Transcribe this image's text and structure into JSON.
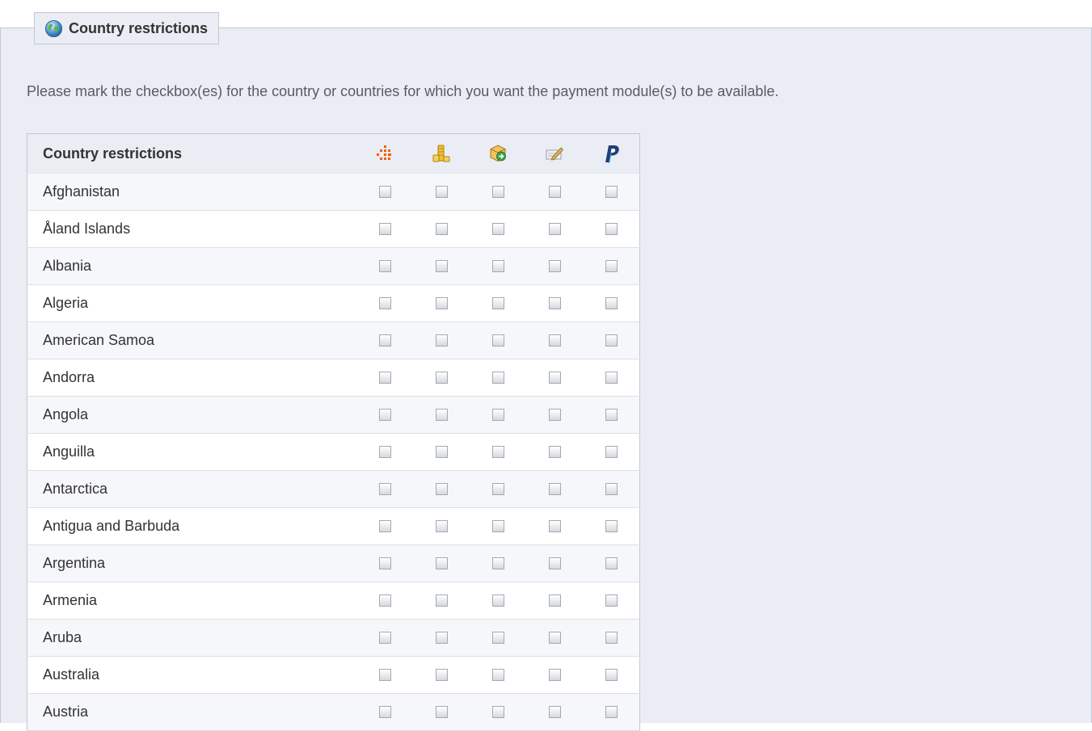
{
  "panel": {
    "legend_title": "Country restrictions",
    "legend_icon": "globe-icon",
    "intro_text": "Please mark the checkbox(es) for the country or countries for which you want the payment module(s) to be available."
  },
  "table": {
    "header": "Country restrictions",
    "modules": [
      {
        "icon": "orange-dots-icon",
        "accent": "#f25c05"
      },
      {
        "icon": "coins-icon",
        "accent": "#e8b520"
      },
      {
        "icon": "box-arrow-icon",
        "accent": "#2e9d3a"
      },
      {
        "icon": "pen-icon",
        "accent": "#c8a04a"
      },
      {
        "icon": "paypal-icon",
        "accent": "#1f3f7a"
      }
    ],
    "rows": [
      {
        "country": "Afghanistan",
        "checked": [
          false,
          false,
          false,
          false,
          false
        ]
      },
      {
        "country": "Åland Islands",
        "checked": [
          false,
          false,
          false,
          false,
          false
        ]
      },
      {
        "country": "Albania",
        "checked": [
          false,
          false,
          false,
          false,
          false
        ]
      },
      {
        "country": "Algeria",
        "checked": [
          false,
          false,
          false,
          false,
          false
        ]
      },
      {
        "country": "American Samoa",
        "checked": [
          false,
          false,
          false,
          false,
          false
        ]
      },
      {
        "country": "Andorra",
        "checked": [
          false,
          false,
          false,
          false,
          false
        ]
      },
      {
        "country": "Angola",
        "checked": [
          false,
          false,
          false,
          false,
          false
        ]
      },
      {
        "country": "Anguilla",
        "checked": [
          false,
          false,
          false,
          false,
          false
        ]
      },
      {
        "country": "Antarctica",
        "checked": [
          false,
          false,
          false,
          false,
          false
        ]
      },
      {
        "country": "Antigua and Barbuda",
        "checked": [
          false,
          false,
          false,
          false,
          false
        ]
      },
      {
        "country": "Argentina",
        "checked": [
          false,
          false,
          false,
          false,
          false
        ]
      },
      {
        "country": "Armenia",
        "checked": [
          false,
          false,
          false,
          false,
          false
        ]
      },
      {
        "country": "Aruba",
        "checked": [
          false,
          false,
          false,
          false,
          false
        ]
      },
      {
        "country": "Australia",
        "checked": [
          false,
          false,
          false,
          false,
          false
        ]
      },
      {
        "country": "Austria",
        "checked": [
          false,
          false,
          false,
          false,
          false
        ]
      }
    ]
  }
}
